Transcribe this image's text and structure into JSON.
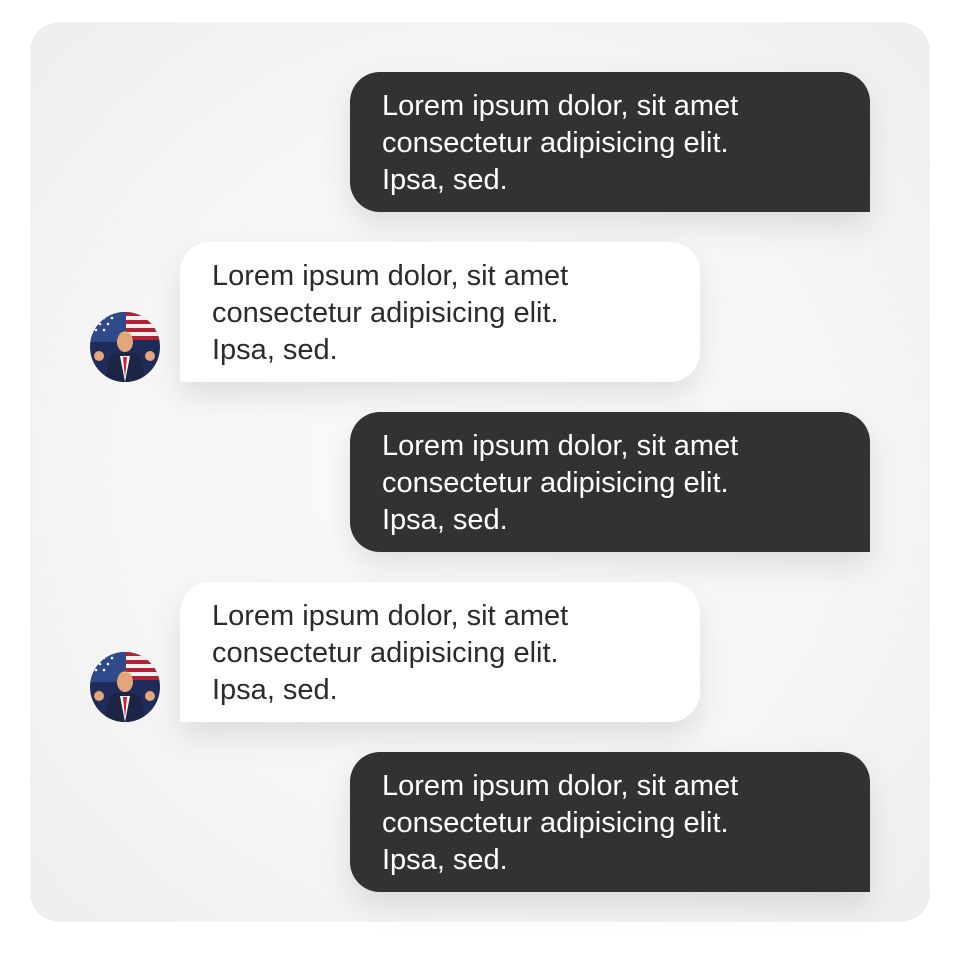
{
  "colors": {
    "panel_background": "#f4f4f4",
    "outgoing_bubble": "#323232",
    "outgoing_text": "#ffffff",
    "incoming_bubble": "#ffffff",
    "incoming_text": "#2b2b2b"
  },
  "messages": [
    {
      "direction": "outgoing",
      "lines": [
        "Lorem ipsum dolor, sit amet",
        "consectetur adipisicing elit.",
        "Ipsa, sed."
      ]
    },
    {
      "direction": "incoming",
      "avatar_icon": "user-photo-avatar-icon",
      "lines": [
        "Lorem ipsum dolor, sit amet",
        "consectetur adipisicing elit.",
        "Ipsa, sed."
      ]
    },
    {
      "direction": "outgoing",
      "lines": [
        "Lorem ipsum dolor, sit amet",
        "consectetur adipisicing elit.",
        "Ipsa, sed."
      ]
    },
    {
      "direction": "incoming",
      "avatar_icon": "user-photo-avatar-icon",
      "lines": [
        "Lorem ipsum dolor, sit amet",
        "consectetur adipisicing elit.",
        "Ipsa, sed."
      ]
    },
    {
      "direction": "outgoing",
      "lines": [
        "Lorem ipsum dolor, sit amet",
        "consectetur adipisicing elit.",
        "Ipsa, sed."
      ]
    }
  ]
}
